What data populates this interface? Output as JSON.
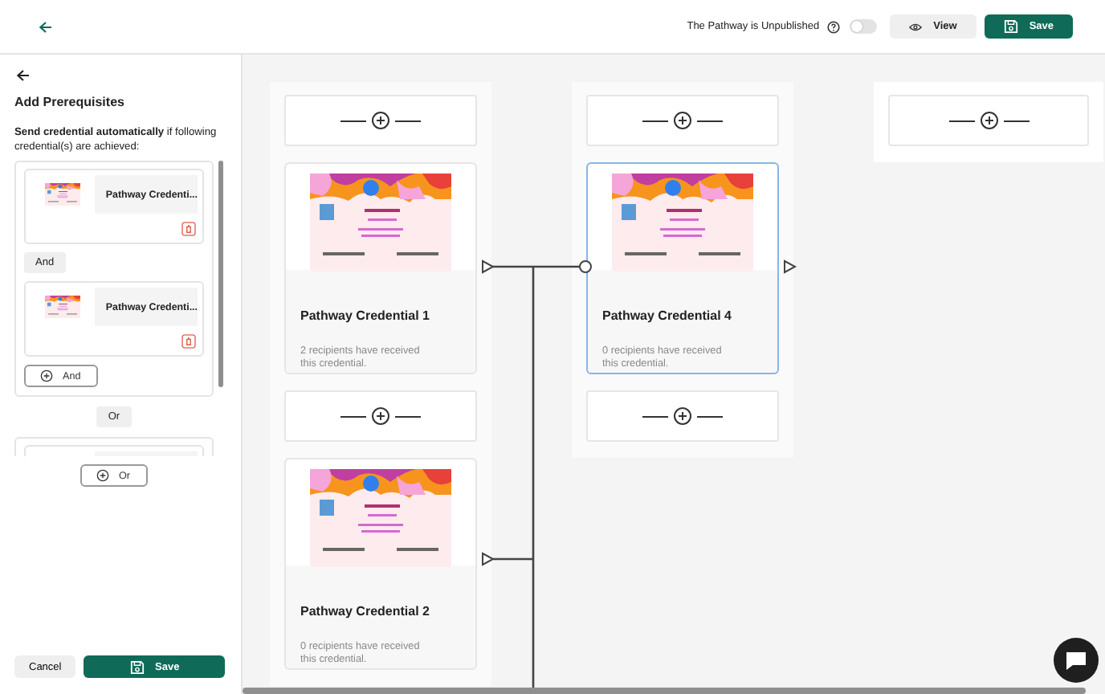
{
  "header": {
    "publish_status": "The Pathway is Unpublished",
    "published": false,
    "view_button": "View",
    "save_button": "Save"
  },
  "prerequisites": {
    "title": "Add Prerequisites",
    "description": "**Send credential automatically** if following credential(s) are achieved:",
    "groups": [
      {
        "cut_off": false,
        "items": [
          {
            "name": "Pathway Credenti..."
          },
          {
            "name": "Pathway Credenti..."
          }
        ],
        "connector": "And",
        "add_button": "And"
      },
      {
        "cut_off": true
      }
    ],
    "or_connector": "Or",
    "add_or_button": "Or",
    "cancel_button": "Cancel",
    "save_button": "Save"
  },
  "canvas": {
    "columns": [
      {
        "nodes": [
          {
            "kind": "add"
          },
          {
            "kind": "credential",
            "title": "Pathway Credential 1",
            "recipients": "2 recipients have received this credential.",
            "selected": false
          },
          {
            "kind": "add"
          },
          {
            "kind": "credential",
            "title": "Pathway Credential 2",
            "recipients": "0 recipients have received this credential.",
            "selected": false
          }
        ]
      },
      {
        "nodes": [
          {
            "kind": "add"
          },
          {
            "kind": "credential",
            "title": "Pathway Credential 4",
            "recipients": "0 recipients have received this credential.",
            "selected": true
          },
          {
            "kind": "add"
          }
        ]
      },
      {
        "nodes": [
          {
            "kind": "add"
          }
        ]
      }
    ]
  }
}
